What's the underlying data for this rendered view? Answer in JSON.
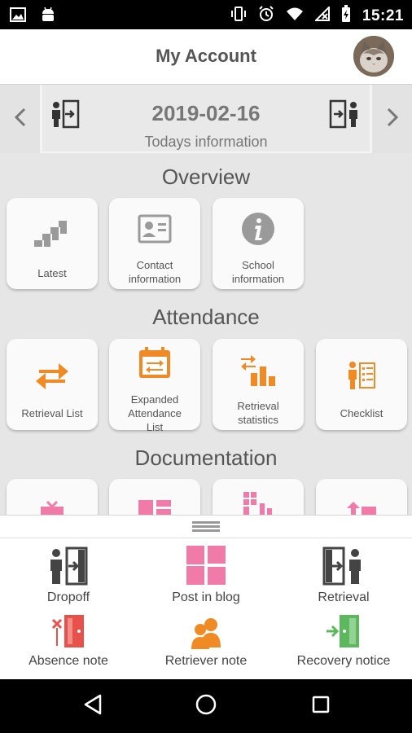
{
  "status_bar": {
    "time": "15:21",
    "left_icons": [
      "image-icon",
      "android-icon"
    ],
    "right_icons": [
      "vibrate-icon",
      "alarm-icon",
      "wifi-icon",
      "no-signal-icon",
      "battery-charging-icon"
    ]
  },
  "header": {
    "title": "My Account",
    "avatar": "cat-avatar"
  },
  "date_nav": {
    "date": "2019-02-16",
    "subtitle": "Todays information",
    "prev_icon": "chevron-left-icon",
    "next_icon": "chevron-right-icon"
  },
  "overview": {
    "title": "Overview",
    "tiles": [
      {
        "label": "Latest",
        "icon": "stairs-icon"
      },
      {
        "label": "Contact\ninformation",
        "icon": "contact-card-icon"
      },
      {
        "label": "School\ninformation",
        "icon": "info-icon"
      }
    ]
  },
  "attendance": {
    "title": "Attendance",
    "tiles": [
      {
        "label": "Retrieval List",
        "icon": "swap-arrows-icon"
      },
      {
        "label": "Expanded\nAttendance\nList",
        "icon": "calendar-swap-icon"
      },
      {
        "label": "Retrieval\nstatistics",
        "icon": "bar-stats-icon"
      },
      {
        "label": "Checklist",
        "icon": "checklist-icon"
      }
    ]
  },
  "documentation": {
    "title": "Documentation"
  },
  "bottom_sheet": {
    "actions": [
      {
        "label": "Dropoff",
        "icon": "dropoff-icon"
      },
      {
        "label": "Post in blog",
        "icon": "blog-grid-icon"
      },
      {
        "label": "Retrieval",
        "icon": "retrieval-icon"
      },
      {
        "label": "Absence note",
        "icon": "absence-door-icon"
      },
      {
        "label": "Retriever note",
        "icon": "people-icon"
      },
      {
        "label": "Recovery notice",
        "icon": "recovery-door-icon"
      }
    ]
  },
  "colors": {
    "accent_orange": "#f08a24",
    "blog_pink": "#f07aa8",
    "absence_red": "#e8504a",
    "recovery_green": "#5cb85c",
    "grey_icon": "#444444"
  }
}
